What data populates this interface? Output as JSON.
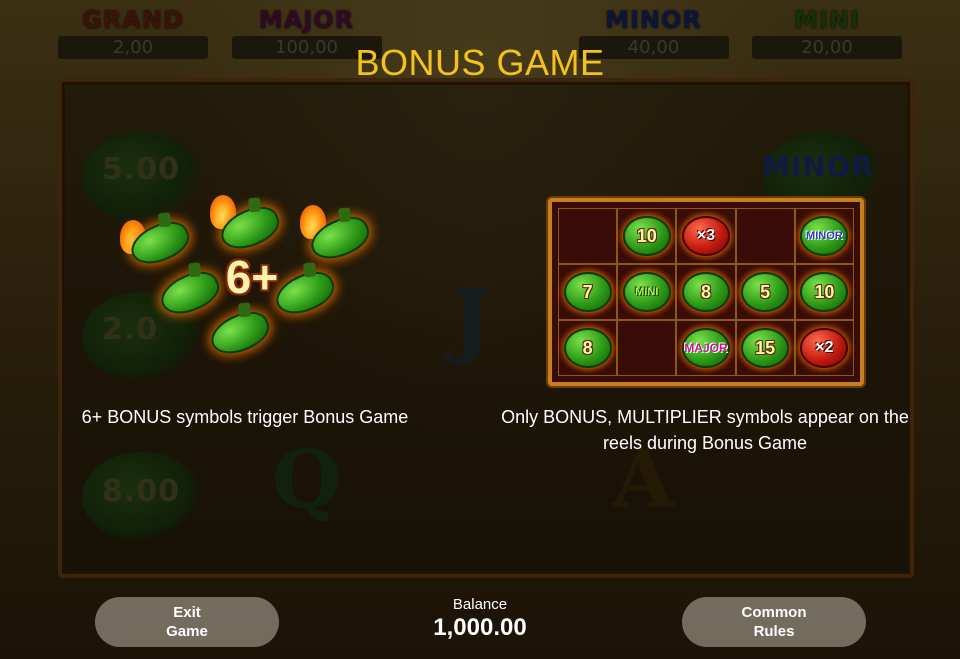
{
  "background": {
    "jackpots": [
      {
        "name": "GRAND",
        "value": "2,00",
        "color": "#7a1e0e"
      },
      {
        "name": "MAJOR",
        "value": "100,00",
        "color": "#5a1040"
      },
      {
        "name": "MINOR",
        "value": "40,00",
        "color": "#1a2a6a"
      },
      {
        "name": "MINI",
        "value": "20,00",
        "color": "#2a5a10"
      }
    ],
    "reel_symbols": [
      "5.00",
      "2.0",
      "8.00",
      "MINOR",
      "J",
      "Q",
      "A"
    ]
  },
  "title": "BONUS GAME",
  "left_panel": {
    "count_label": "6+",
    "caption": "6+ BONUS symbols trigger Bonus Game"
  },
  "right_panel": {
    "grid": [
      [
        {
          "type": "empty"
        },
        {
          "type": "green",
          "text": "10"
        },
        {
          "type": "red",
          "text": "×3"
        },
        {
          "type": "empty"
        },
        {
          "type": "green",
          "text": "MINOR",
          "kind": "jp-minor"
        }
      ],
      [
        {
          "type": "green",
          "text": "7"
        },
        {
          "type": "green",
          "text": "MINI",
          "kind": "jp-mini"
        },
        {
          "type": "green",
          "text": "8"
        },
        {
          "type": "green",
          "text": "5"
        },
        {
          "type": "green",
          "text": "10"
        }
      ],
      [
        {
          "type": "green",
          "text": "8"
        },
        {
          "type": "empty"
        },
        {
          "type": "green",
          "text": "MAJOR",
          "kind": "jp-major"
        },
        {
          "type": "green",
          "text": "15"
        },
        {
          "type": "red",
          "text": "×2"
        }
      ]
    ],
    "caption": "Only BONUS, MULTIPLIER symbols appear on the reels during Bonus Game"
  },
  "footer": {
    "exit_label": "Exit\nGame",
    "balance_label": "Balance",
    "balance_value": "1,000.00",
    "rules_label": "Common\nRules"
  },
  "colors": {
    "title": "#f5c21b",
    "frame": "#c7801f"
  }
}
